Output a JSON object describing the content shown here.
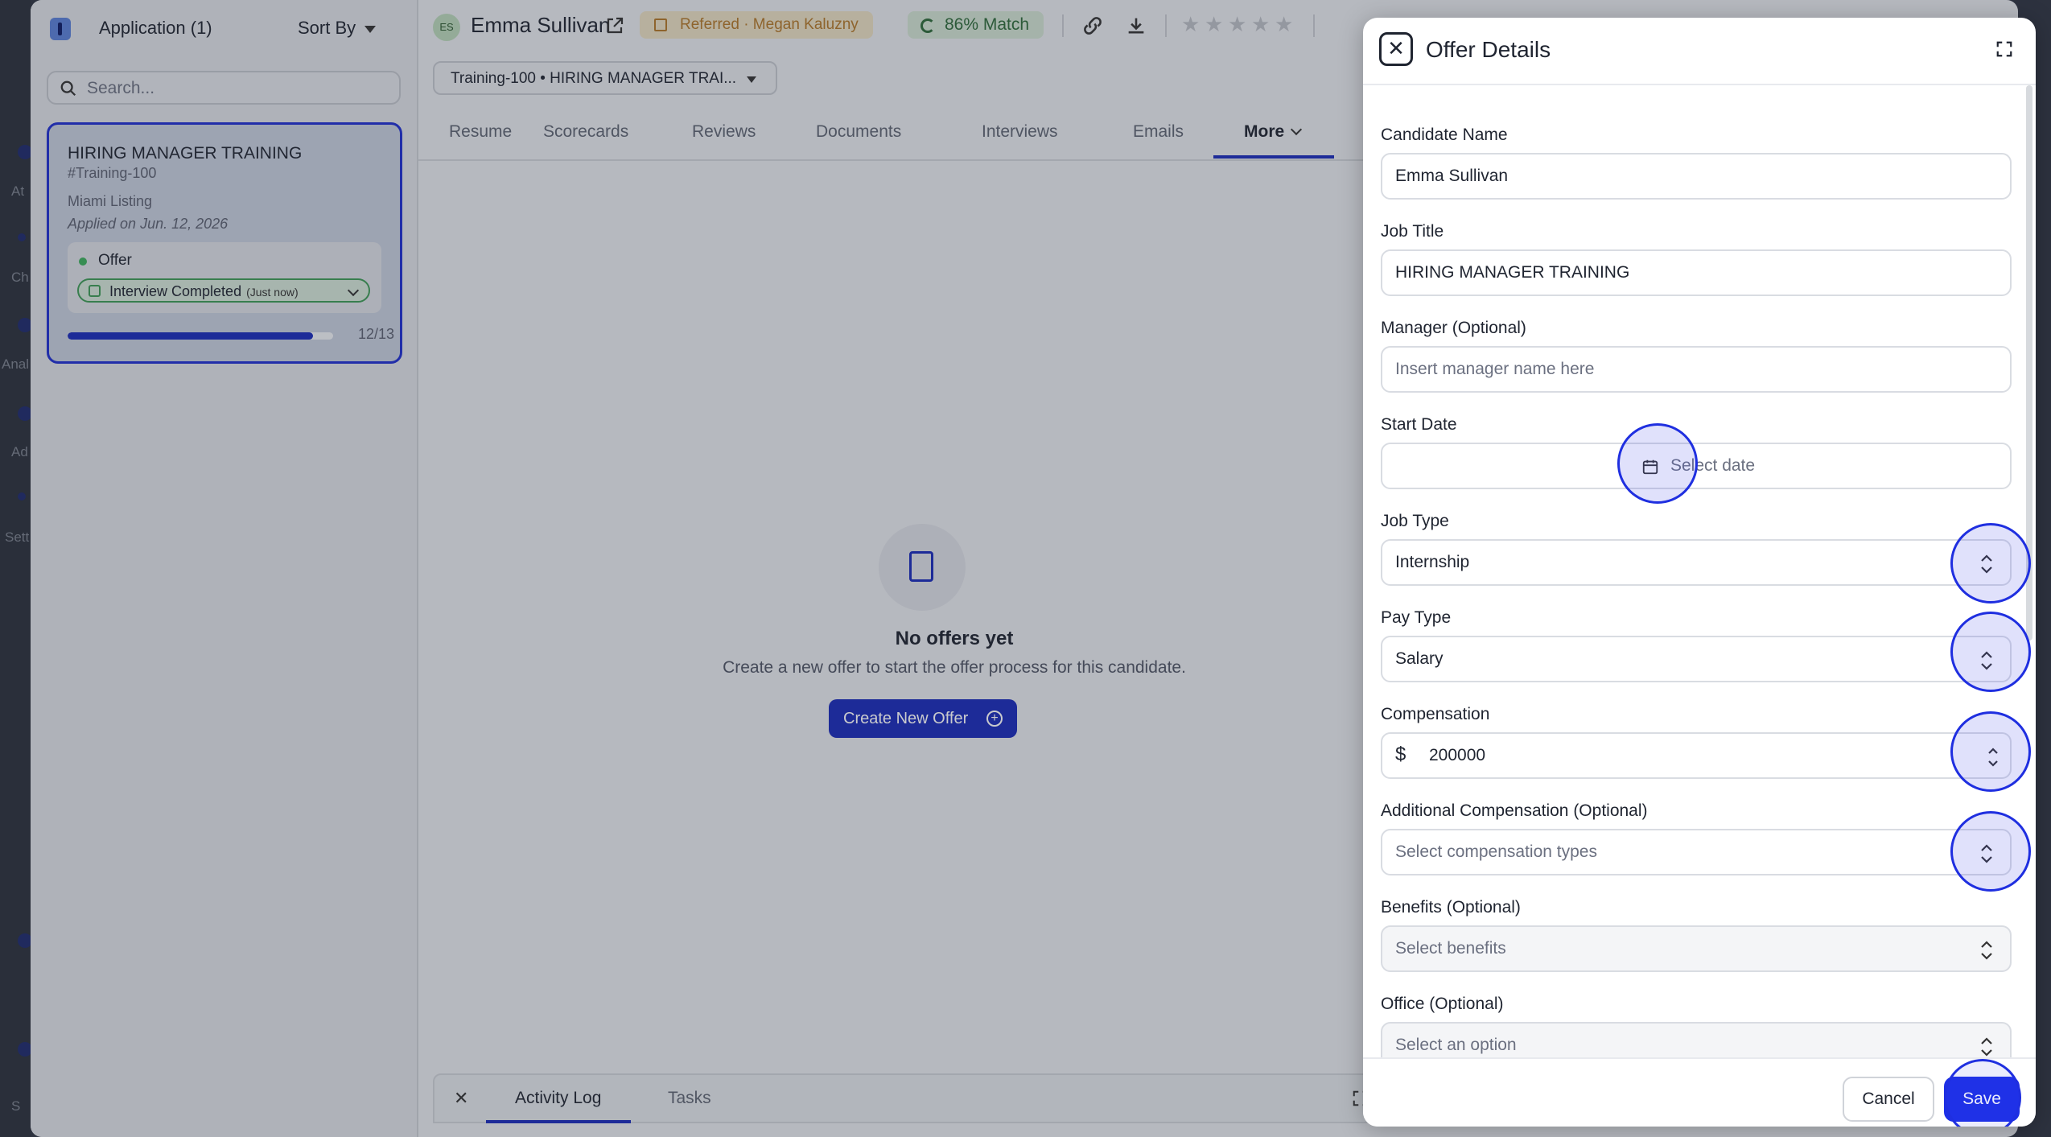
{
  "nav": {
    "labels": [
      "At",
      "Ch",
      "Anal",
      "Ad",
      "Sett",
      "S"
    ]
  },
  "sidebar": {
    "title": "Application (1)",
    "sort_label": "Sort By",
    "search_placeholder": "Search...",
    "card": {
      "title": "HIRING MANAGER TRAINING",
      "code": "#Training-100",
      "location": "Miami Listing",
      "applied": "Applied on Jun. 12, 2026",
      "stage": "Offer",
      "status": "Interview Completed",
      "status_time": "(Just now)",
      "progress_text": "12/13",
      "progress_fraction": 0.923
    }
  },
  "header": {
    "avatar_initials": "ES",
    "candidate_name": "Emma Sullivan",
    "referred": "Referred · Megan Kaluzny",
    "match": "86% Match",
    "rating": 0,
    "rating_max": 5
  },
  "job_select": {
    "value": "Training-100 • HIRING MANAGER TRAI..."
  },
  "tabs": [
    "Resume",
    "Scorecards",
    "Reviews",
    "Documents",
    "Interviews",
    "Emails",
    "More"
  ],
  "empty_state": {
    "title": "No offers yet",
    "subtitle": "Create a new offer to start the offer process for this candidate.",
    "button": "Create New Offer"
  },
  "bottom_panel": {
    "tabs": [
      "Activity Log",
      "Tasks"
    ]
  },
  "modal": {
    "title": "Offer Details",
    "fields": {
      "candidate_name": {
        "label": "Candidate Name",
        "value": "Emma Sullivan"
      },
      "job_title": {
        "label": "Job Title",
        "value": "HIRING MANAGER TRAINING"
      },
      "manager": {
        "label": "Manager (Optional)",
        "placeholder": "Insert manager name here"
      },
      "start_date": {
        "label": "Start Date",
        "placeholder": "Select date"
      },
      "job_type": {
        "label": "Job Type",
        "value": "Internship"
      },
      "pay_type": {
        "label": "Pay Type",
        "value": "Salary"
      },
      "compensation": {
        "label": "Compensation",
        "currency": "$",
        "value": "200000"
      },
      "additional_compensation": {
        "label": "Additional Compensation (Optional)",
        "placeholder": "Select compensation types"
      },
      "benefits": {
        "label": "Benefits (Optional)",
        "placeholder": "Select benefits"
      },
      "office": {
        "label": "Office (Optional)",
        "placeholder": "Select an option"
      }
    },
    "cancel_label": "Cancel",
    "save_label": "Save"
  },
  "colors": {
    "brand_blue": "#1a2bb8",
    "save_blue": "#1c2fe8",
    "highlight_ring": "#1f2fe0",
    "referred": "#b0772a",
    "match": "#2e6a3a"
  }
}
